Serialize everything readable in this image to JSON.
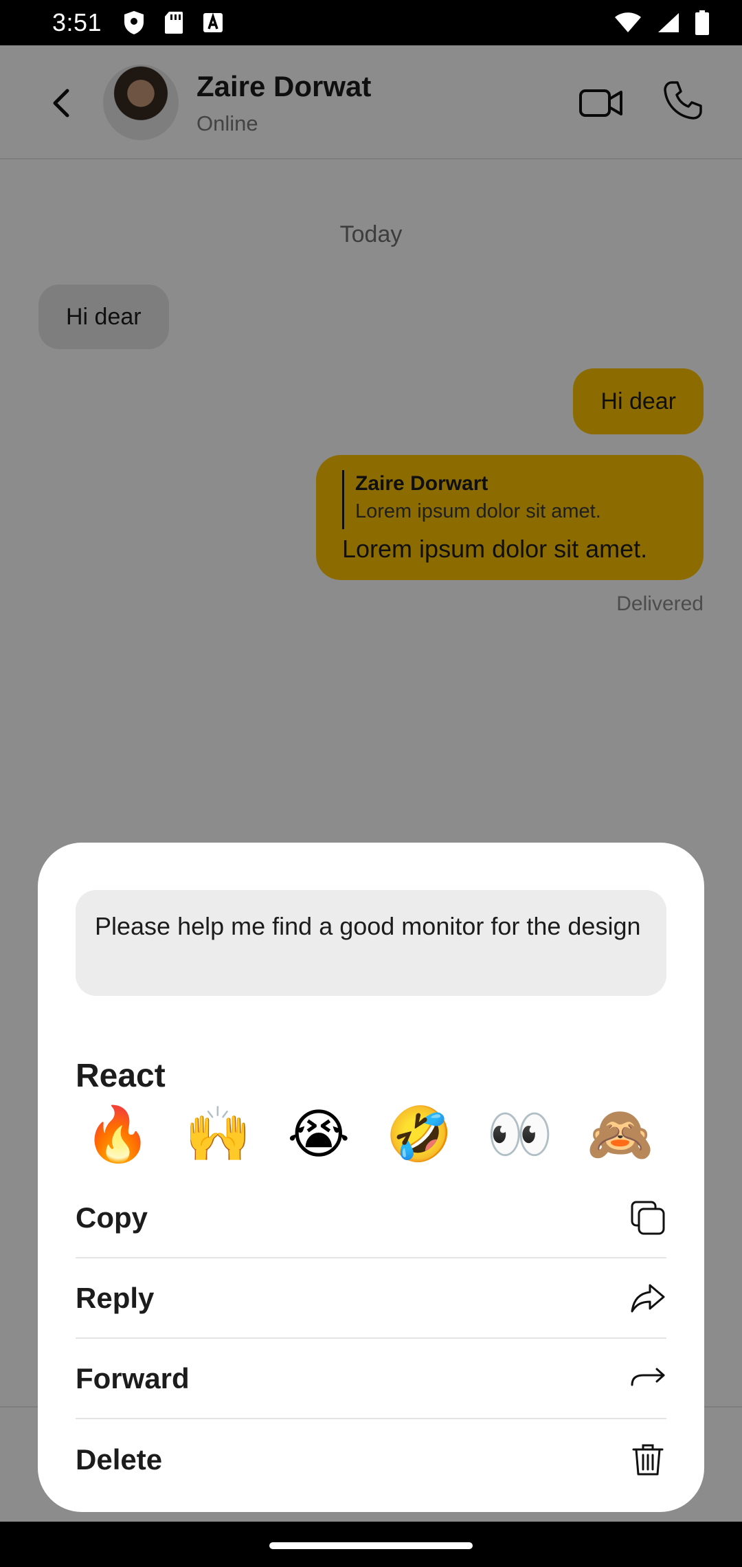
{
  "status_bar": {
    "time": "3:51",
    "left_icons": [
      "shield-icon",
      "sd-card-icon",
      "font-a-icon"
    ],
    "right_icons": [
      "wifi-icon",
      "signal-icon",
      "battery-icon"
    ]
  },
  "header": {
    "contact_name": "Zaire Dorwat",
    "contact_status": "Online",
    "icons": [
      "back-icon",
      "video-call-icon",
      "phone-call-icon"
    ]
  },
  "chat": {
    "date_separator": "Today",
    "messages": [
      {
        "direction": "incoming",
        "text": "Hi dear"
      },
      {
        "direction": "outgoing",
        "text": "Hi dear"
      },
      {
        "direction": "outgoing",
        "reply_to": {
          "name": "Zaire Dorwart",
          "text": "Lorem ipsum dolor sit amet."
        },
        "text": "Lorem ipsum dolor sit amet."
      }
    ],
    "delivery_status": "Delivered"
  },
  "sheet": {
    "preview_text": "Please help me find a good monitor for the design",
    "react_title": "React",
    "reactions": [
      {
        "name": "fire",
        "glyph": "🔥"
      },
      {
        "name": "raising-hands",
        "glyph": "🙌"
      },
      {
        "name": "crying",
        "glyph": "😭"
      },
      {
        "name": "rofl",
        "glyph": "🤣"
      },
      {
        "name": "eyes",
        "glyph": "👀"
      },
      {
        "name": "see-no-evil-monkey",
        "glyph": "🙈"
      }
    ],
    "menu": [
      {
        "label": "Copy",
        "icon": "copy-icon"
      },
      {
        "label": "Reply",
        "icon": "reply-icon"
      },
      {
        "label": "Forward",
        "icon": "forward-icon"
      },
      {
        "label": "Delete",
        "icon": "trash-icon"
      }
    ]
  },
  "colors": {
    "outgoing_bubble": "#FFC501",
    "incoming_bubble": "#E6E6E6",
    "overlay": "rgba(0,0,0,0.45)",
    "text": "#1C1C1C"
  }
}
